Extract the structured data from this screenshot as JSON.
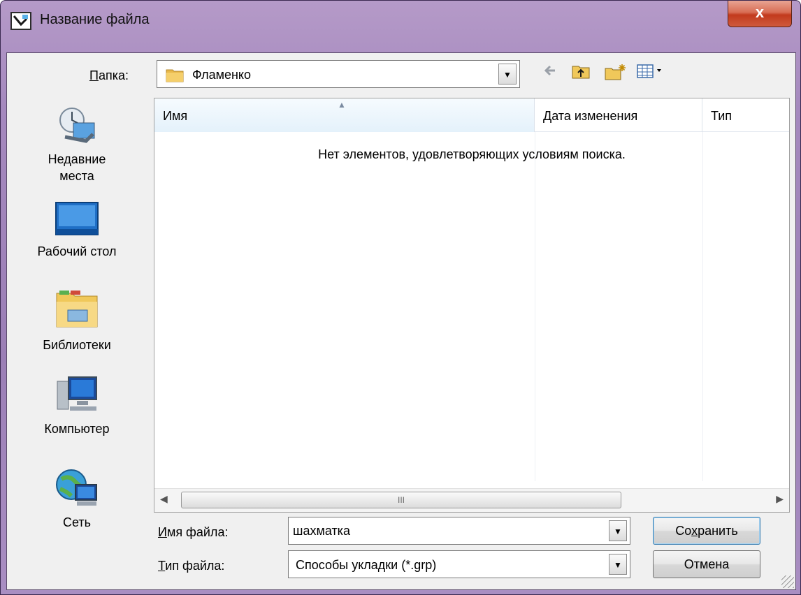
{
  "window": {
    "title": "Название файла",
    "close_label": "x"
  },
  "toolbar": {
    "folder_label": "Папка:",
    "folder_value": "Фламенко",
    "back_icon": "back-arrow-icon",
    "up_icon": "up-folder-icon",
    "new_folder_icon": "new-folder-icon",
    "view_icon": "view-menu-icon"
  },
  "places": [
    {
      "label": "Недавние места",
      "icon": "recent-places-icon"
    },
    {
      "label": "Рабочий стол",
      "icon": "desktop-icon"
    },
    {
      "label": "Библиотеки",
      "icon": "libraries-icon"
    },
    {
      "label": "Компьютер",
      "icon": "computer-icon"
    },
    {
      "label": "Сеть",
      "icon": "network-icon"
    }
  ],
  "file_list": {
    "columns": [
      "Имя",
      "Дата изменения",
      "Тип"
    ],
    "empty_message": "Нет элементов, удовлетворяющих условиям поиска.",
    "scroll_grip": "III"
  },
  "form": {
    "filename_label": "Имя файла:",
    "filename_value": "шахматка",
    "filetype_label": "Тип файла:",
    "filetype_value": "Способы укладки (*.grp)"
  },
  "buttons": {
    "save": "Сохранить",
    "cancel": "Отмена"
  },
  "colors": {
    "frame": "#a589be",
    "close": "#c23a1d",
    "dialog_bg": "#f0f0f0"
  }
}
